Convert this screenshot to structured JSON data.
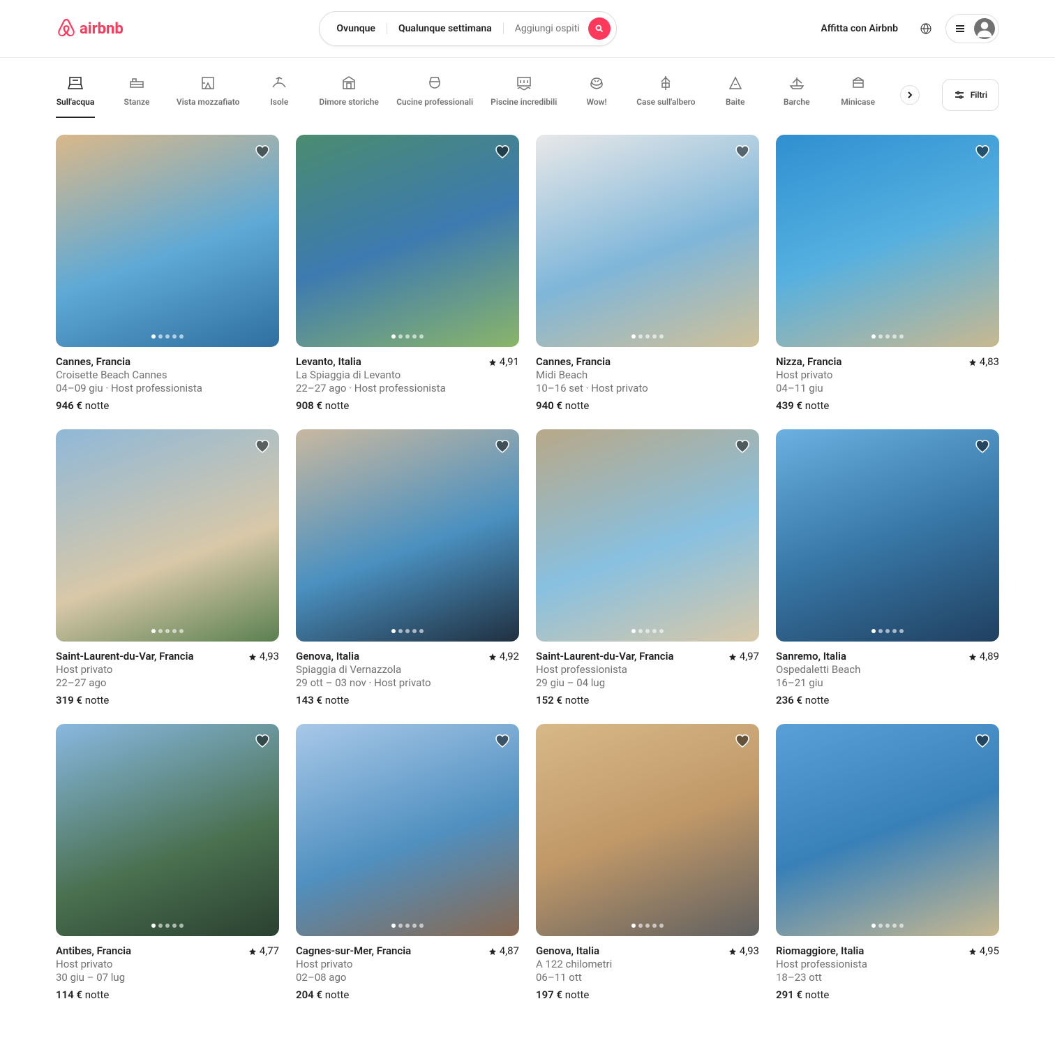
{
  "header": {
    "logo_text": "airbnb",
    "search": {
      "where": "Ovunque",
      "when": "Qualunque settimana",
      "guests": "Aggiungi ospiti"
    },
    "host_link": "Affitta con Airbnb"
  },
  "categories": [
    {
      "label": "Sull'acqua",
      "active": true
    },
    {
      "label": "Stanze",
      "active": false
    },
    {
      "label": "Vista mozzafiato",
      "active": false
    },
    {
      "label": "Isole",
      "active": false
    },
    {
      "label": "Dimore storiche",
      "active": false
    },
    {
      "label": "Cucine professionali",
      "active": false
    },
    {
      "label": "Piscine incredibili",
      "active": false
    },
    {
      "label": "Wow!",
      "active": false
    },
    {
      "label": "Case sull'albero",
      "active": false
    },
    {
      "label": "Baite",
      "active": false
    },
    {
      "label": "Barche",
      "active": false
    },
    {
      "label": "Minicase",
      "active": false
    }
  ],
  "filters_label": "Filtri",
  "per_night_label": "notte",
  "listings": [
    {
      "location": "Cannes, Francia",
      "subtitle": "Croisette Beach Cannes",
      "dates": "04–09 giu · Host professionista",
      "price": "946 €",
      "rating": null
    },
    {
      "location": "Levanto, Italia",
      "subtitle": "La Spiaggia di Levanto",
      "dates": "22–27 ago · Host professionista",
      "price": "908 €",
      "rating": "4,91"
    },
    {
      "location": "Cannes, Francia",
      "subtitle": "Midi Beach",
      "dates": "10–16 set · Host privato",
      "price": "940 €",
      "rating": null
    },
    {
      "location": "Nizza, Francia",
      "subtitle": "Host privato",
      "dates": "04–11 giu",
      "price": "439 €",
      "rating": "4,83"
    },
    {
      "location": "Saint-Laurent-du-Var, Francia",
      "subtitle": "Host privato",
      "dates": "22–27 ago",
      "price": "319 €",
      "rating": "4,93"
    },
    {
      "location": "Genova, Italia",
      "subtitle": "Spiaggia di Vernazzola",
      "dates": "29 ott – 03 nov · Host privato",
      "price": "143 €",
      "rating": "4,92"
    },
    {
      "location": "Saint-Laurent-du-Var, Francia",
      "subtitle": "Host professionista",
      "dates": "29 giu – 04 lug",
      "price": "152 €",
      "rating": "4,97"
    },
    {
      "location": "Sanremo, Italia",
      "subtitle": "Ospedaletti Beach",
      "dates": "16–21 giu",
      "price": "236 €",
      "rating": "4,89"
    },
    {
      "location": "Antibes, Francia",
      "subtitle": "Host privato",
      "dates": "30 giu – 07 lug",
      "price": "114 €",
      "rating": "4,77"
    },
    {
      "location": "Cagnes-sur-Mer, Francia",
      "subtitle": "Host privato",
      "dates": "02–08 ago",
      "price": "204 €",
      "rating": "4,87"
    },
    {
      "location": "Genova, Italia",
      "subtitle": "A 122 chilometri",
      "dates": "06–11 ott",
      "price": "197 €",
      "rating": "4,93"
    },
    {
      "location": "Riomaggiore, Italia",
      "subtitle": "Host professionista",
      "dates": "18–23 ott",
      "price": "291 €",
      "rating": "4,95"
    }
  ]
}
